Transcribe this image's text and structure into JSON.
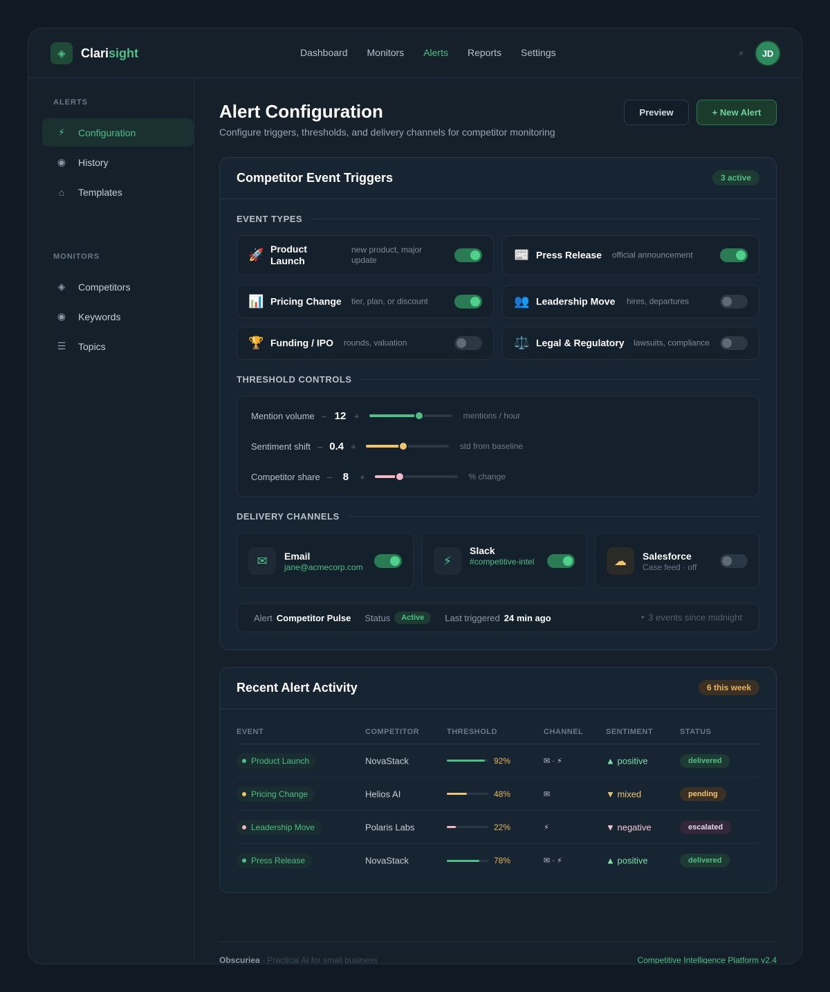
{
  "app": {
    "brand_a": "Clari",
    "brand_b": "sight",
    "logo_icon": "diamond-icon",
    "avatar": "JD"
  },
  "nav": [
    "Dashboard",
    "Monitors",
    "Alerts",
    "Reports",
    "Settings"
  ],
  "nav_active": "Alerts",
  "sidebar": {
    "section_alerts": "ALERTS",
    "alerts": [
      {
        "label": "Configuration",
        "icon": "⚡",
        "active": true
      },
      {
        "label": "History",
        "icon": "◉"
      },
      {
        "label": "Templates",
        "icon": "⌂"
      }
    ],
    "section_monitors": "MONITORS",
    "monitors": [
      {
        "label": "Competitors",
        "icon": "◈"
      },
      {
        "label": "Keywords",
        "icon": "◉"
      },
      {
        "label": "Topics",
        "icon": "☰"
      }
    ]
  },
  "page": {
    "title": "Alert Configuration",
    "subtitle": "Configure triggers, thresholds, and delivery channels for competitor monitoring",
    "preview_label": "Preview",
    "new_label": "+ New Alert"
  },
  "triggers": {
    "title": "Competitor Event Triggers",
    "badge": "3 active",
    "event_types_label": "EVENT TYPES",
    "events": [
      {
        "name": "Product Launch",
        "desc": "new product, major update",
        "icon": "🚀",
        "on": true
      },
      {
        "name": "Press Release",
        "desc": "official announcement",
        "icon": "📰",
        "on": true
      },
      {
        "name": "Pricing Change",
        "desc": "tier, plan, or discount",
        "icon": "📊",
        "on": true
      },
      {
        "name": "Leadership Move",
        "desc": "hires, departures",
        "icon": "👥",
        "on": false
      },
      {
        "name": "Funding / IPO",
        "desc": "rounds, valuation",
        "icon": "🏆",
        "on": false
      },
      {
        "name": "Legal & Regulatory",
        "desc": "lawsuits, compliance",
        "icon": "⚖️",
        "on": false
      }
    ],
    "threshold_label": "THRESHOLD CONTROLS",
    "thresholds": [
      {
        "label": "Mention volume",
        "value": "12",
        "unit": "mentions / hour",
        "level": 0.6,
        "color": "#4fbf85"
      },
      {
        "label": "Sentiment shift",
        "value": "0.4",
        "unit": "std from baseline",
        "level": 0.45,
        "color": "#f0c56e"
      },
      {
        "label": "Competitor share",
        "value": "8",
        "unit": "% change",
        "level": 0.3,
        "color": "#f4b8c4"
      }
    ],
    "delivery_label": "DELIVERY CHANNELS",
    "channels": [
      {
        "name": "Email",
        "sub": "jane@acmecorp.com",
        "icon": "✉",
        "on": true
      },
      {
        "name": "Slack",
        "sub": "#competitive-intel",
        "icon": "⚡",
        "on": true
      },
      {
        "name": "Salesforce",
        "sub": "Case feed · off",
        "icon": "☁",
        "on": false
      }
    ],
    "status": {
      "alert_key": "Alert",
      "alert_val": "Competitor Pulse",
      "status_key": "Status",
      "status_val": "Active",
      "last_key": "Last triggered",
      "last_val": "24 min ago",
      "trail": "3 events since midnight"
    }
  },
  "activity": {
    "title": "Recent Alert Activity",
    "badge": "6 this week",
    "columns": [
      "EVENT",
      "COMPETITOR",
      "THRESHOLD",
      "CHANNEL",
      "SENTIMENT",
      "STATUS"
    ],
    "rows": [
      {
        "event": "Product Launch",
        "dot": "#4fbf85",
        "competitor": "NovaStack",
        "threshold": "92%",
        "level": 0.92,
        "channel": "✉ · ⚡",
        "sentiment": "▲ positive",
        "sent_color": "#7ee0a8",
        "status": "delivered"
      },
      {
        "event": "Pricing Change",
        "dot": "#f0c56e",
        "competitor": "Helios AI",
        "threshold": "48%",
        "level": 0.48,
        "channel": "✉",
        "sentiment": "▼ mixed",
        "sent_color": "#f0c56e",
        "status": "pending"
      },
      {
        "event": "Leadership Move",
        "dot": "#f4b8c4",
        "competitor": "Polaris Labs",
        "threshold": "22%",
        "level": 0.22,
        "channel": "⚡",
        "sentiment": "▼ negative",
        "sent_color": "#f4c7d0",
        "status": "escalated"
      },
      {
        "event": "Press Release",
        "dot": "#4fbf85",
        "competitor": "NovaStack",
        "threshold": "78%",
        "level": 0.78,
        "channel": "✉ · ⚡",
        "sentiment": "▲ positive",
        "sent_color": "#7ee0a8",
        "status": "delivered"
      }
    ]
  },
  "footer": {
    "brand": "Obscuriea",
    "tagline": "· Practical AI for small business",
    "right": "Competitive Intelligence Platform v2.4"
  }
}
